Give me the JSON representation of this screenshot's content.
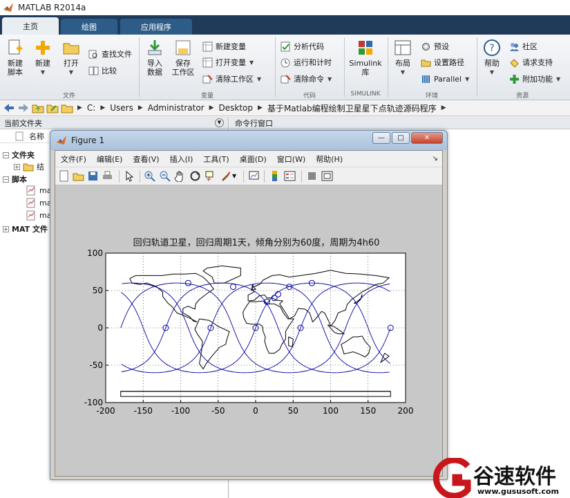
{
  "app": {
    "title": "MATLAB R2014a"
  },
  "tabs": [
    {
      "label": "主页",
      "active": true
    },
    {
      "label": "绘图",
      "active": false
    },
    {
      "label": "应用程序",
      "active": false
    }
  ],
  "ribbon": {
    "file": {
      "group_label": "文件",
      "new_script": "新建\n脚本",
      "new": "新建",
      "open": "打开",
      "find_files": "查找文件",
      "compare": "比较"
    },
    "variable": {
      "group_label": "变量",
      "import_data": "导入\n数据",
      "save_workspace": "保存\n工作区",
      "new_variable": "新建变量",
      "open_variable": "打开变量",
      "clear_workspace": "清除工作区"
    },
    "code": {
      "group_label": "代码",
      "analyze_code": "分析代码",
      "run_and_time": "运行和计时",
      "clear_commands": "清除命令"
    },
    "simulink": {
      "group_label": "SIMULINK",
      "library": "Simulink\n库"
    },
    "environment": {
      "group_label": "环境",
      "layout": "布局",
      "preferences": "预设",
      "set_path": "设置路径",
      "parallel": "Parallel"
    },
    "resources": {
      "group_label": "资源",
      "help": "帮助",
      "community": "社区",
      "request_support": "请求支持",
      "add_ons": "附加功能"
    }
  },
  "address": {
    "crumbs": [
      "C:",
      "Users",
      "Administrator",
      "Desktop",
      "基于Matlab编程绘制卫星星下点轨迹源码程序"
    ]
  },
  "current_folder": {
    "title": "当前文件夹",
    "column_name": "名称",
    "tree": [
      {
        "label": "文件夹",
        "bold": true
      },
      {
        "label": "结",
        "bold": false
      },
      {
        "label": "脚本",
        "bold": true
      },
      {
        "label": "ma",
        "bold": false
      },
      {
        "label": "ma",
        "bold": false
      },
      {
        "label": "ma",
        "bold": false
      },
      {
        "label": "MAT 文件",
        "bold": true
      }
    ]
  },
  "command_window": {
    "title": "命令行窗口"
  },
  "figure": {
    "title": "Figure 1",
    "menu": [
      "文件(F)",
      "编辑(E)",
      "查看(V)",
      "插入(I)",
      "工具(T)",
      "桌面(D)",
      "窗口(W)",
      "帮助(H)"
    ]
  },
  "chart_data": {
    "type": "line",
    "title": "回归轨道卫星，回归周期1天，倾角分别为60度，周期为4h60",
    "xlabel": "",
    "ylabel": "",
    "xlim": [
      -200,
      200
    ],
    "ylim": [
      -100,
      100
    ],
    "xticks": [
      -200,
      -150,
      -100,
      -50,
      0,
      50,
      100,
      150,
      200
    ],
    "yticks": [
      100,
      50,
      0,
      -50,
      -100
    ],
    "grid": true,
    "series_color": "#0000a0",
    "track": {
      "inclination_deg": 60,
      "orbits_per_day": 6,
      "ascending_nodes_lon": [
        -120,
        -60,
        0,
        60,
        120,
        180
      ]
    },
    "markers": [
      {
        "x": -120,
        "y": 0
      },
      {
        "x": -60,
        "y": 0
      },
      {
        "x": 0,
        "y": 0
      },
      {
        "x": 60,
        "y": 0
      },
      {
        "x": 180,
        "y": 0
      },
      {
        "x": -90,
        "y": 60
      },
      {
        "x": -30,
        "y": 55
      },
      {
        "x": 30,
        "y": 45
      },
      {
        "x": 45,
        "y": 55
      },
      {
        "x": 75,
        "y": 60
      },
      {
        "x": 15,
        "y": 35
      },
      {
        "x": 25,
        "y": 40
      }
    ]
  },
  "watermark": {
    "brand": "谷速软件",
    "url": "www.gususoft.com"
  },
  "colors": {
    "tab_bar": "#1f3b59",
    "brand_red": "#c8161d"
  }
}
